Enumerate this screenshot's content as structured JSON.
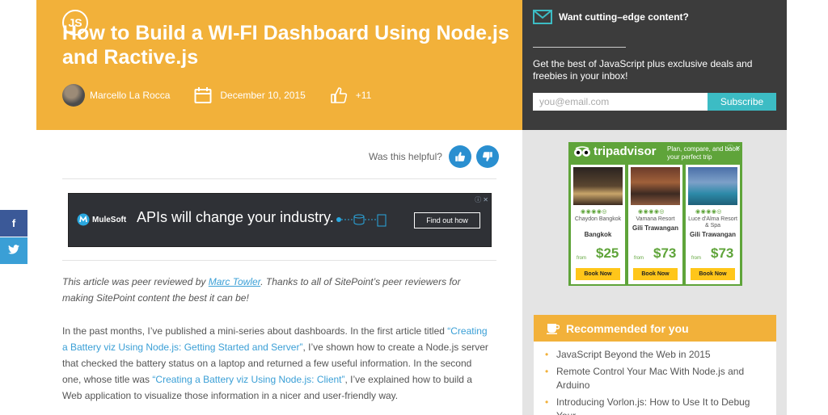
{
  "header": {
    "badge": "JS",
    "title": "How to Build a WI-FI Dashboard Using Node.js and Ractive.js",
    "author": "Marcello La Rocca",
    "date": "December 10, 2015",
    "likes": "+11",
    "accent_color": "#f2b13a"
  },
  "newsletter": {
    "heading": "Want cutting–edge content?",
    "description": "Get the best of JavaScript plus exclusive deals and freebies in your inbox!",
    "email_placeholder": "you@email.com",
    "subscribe_label": "Subscribe"
  },
  "social": {
    "facebook_glyph": "f",
    "twitter_glyph": "🐦"
  },
  "helpful": {
    "question": "Was this helpful?"
  },
  "banner_ad": {
    "brand": "MuleSoft",
    "headline": "APIs will change your industry.",
    "button": "Find out how",
    "info": "ⓘ ✕"
  },
  "article": {
    "review_prefix": "This article was peer reviewed by ",
    "reviewer": "Marc Towler",
    "review_suffix": ". Thanks to all of SitePoint’s peer reviewers for making SitePoint content the best it can be!",
    "p1_a": "In the past months, I’ve published a mini-series about dashboards. In the first article titled ",
    "p1_link1": "“Creating a Battery viz Using Node.js: Getting Started and Server”",
    "p1_b": ", I’ve shown how to create a Node.js server that checked the battery status on a laptop and returned a few useful information. In the second one, whose title was ",
    "p1_link2": "“Creating a Battery viz Using Node.js: Client”",
    "p1_c": ", I’ve explained how to build a Web application to visualize those information in a nicer and user-friendly way."
  },
  "tripadvisor": {
    "brand": "tripadvisor",
    "tagline": "Plan, compare, and book your perfect trip",
    "close": "ⓘ ✕",
    "hotels": [
      {
        "name": "Chaydon Bangkok",
        "city": "Bangkok",
        "from": "from",
        "price": "$25",
        "book": "Book Now",
        "bubbles": "◉◉◉◉◎"
      },
      {
        "name": "Vamana Resort",
        "city": "Gili Trawangan",
        "from": "from",
        "price": "$73",
        "book": "Book Now",
        "bubbles": "◉◉◉◉◎"
      },
      {
        "name": "Luce d'Alma Resort & Spa",
        "city": "Gili Trawangan",
        "from": "from",
        "price": "$73",
        "book": "Book Now",
        "bubbles": "◉◉◉◉◎"
      }
    ]
  },
  "recommended": {
    "heading": "Recommended for you",
    "items": [
      "JavaScript Beyond the Web in 2015",
      "Remote Control Your Mac With Node.js and Arduino",
      "Introducing Vorlon.js: How to Use It to Debug Your"
    ]
  }
}
